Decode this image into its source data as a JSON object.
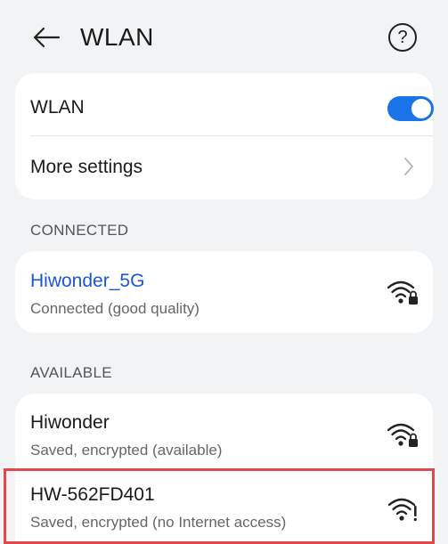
{
  "header": {
    "title": "WLAN",
    "help_glyph": "?"
  },
  "settings": {
    "wlan_label": "WLAN",
    "wlan_enabled": true,
    "more_settings_label": "More settings"
  },
  "sections": {
    "connected_label": "CONNECTED",
    "available_label": "AVAILABLE"
  },
  "connected_network": {
    "name": "Hiwonder_5G",
    "status": "Connected (good quality)",
    "icon": "wifi-locked-icon"
  },
  "available_networks": [
    {
      "name": "Hiwonder",
      "status": "Saved, encrypted (available)",
      "icon": "wifi-locked-icon"
    },
    {
      "name": "HW-562FD401",
      "status": "Saved, encrypted (no Internet access)",
      "icon": "wifi-warning-icon"
    }
  ],
  "colors": {
    "accent": "#1a73e8",
    "connected_text": "#1a57d6",
    "highlight": "#e0494a",
    "background": "#f1f3f5"
  }
}
